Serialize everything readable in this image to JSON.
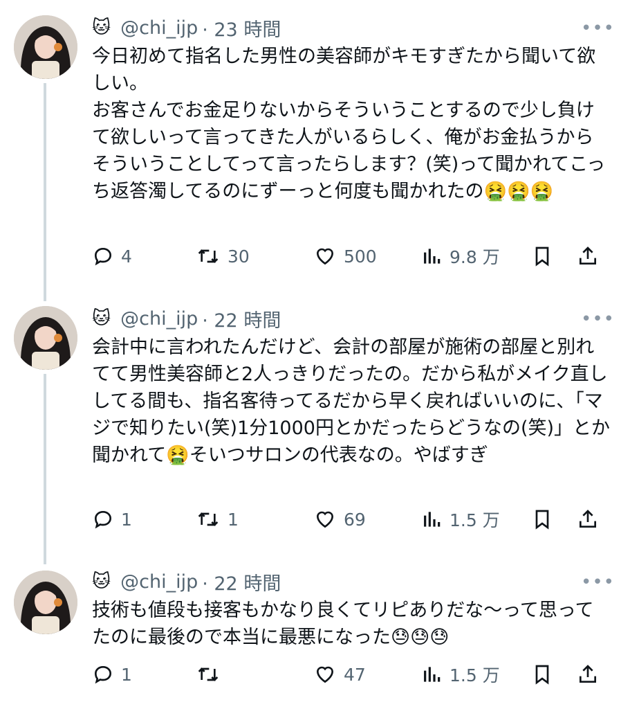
{
  "tweets": [
    {
      "handle": "@chi_ijp",
      "time": "· 23 時間",
      "more": "•••",
      "text": "今日初めて指名した男性の美容師がキモすぎたから聞いて欲しい。\nお客さんでお金足りないからそういうことするので少し負けて欲しいって言ってきた人がいるらしく、俺がお金払うからそういうことしてって言ったらします？(笑)って聞かれてこっち返答濁してるのにずーっと何度も聞かれたの🤮🤮🤮",
      "replies": "4",
      "retweets": "30",
      "likes": "500",
      "views": "9.8 万"
    },
    {
      "handle": "@chi_ijp",
      "time": "· 22 時間",
      "more": "•••",
      "text": "会計中に言われたんだけど、会計の部屋が施術の部屋と別れてて男性美容師と2人っきりだったの。だから私がメイク直ししてる間も、指名客待ってるだから早く戻ればいいのに、「マジで知りたい(笑)1分1000円とかだったらどうなの(笑)」とか聞かれて🤮そいつサロンの代表なの。やばすぎ",
      "replies": "1",
      "retweets": "1",
      "likes": "69",
      "views": "1.5 万"
    },
    {
      "handle": "@chi_ijp",
      "time": "· 22 時間",
      "more": "•••",
      "text": "技術も値段も接客もかなり良くてリピありだな〜って思ってたのに最後ので本当に最悪になった😓😓😓",
      "replies": "1",
      "retweets": "",
      "likes": "47",
      "views": "1.5 万"
    }
  ],
  "icons": {
    "name_emoji": "🐱",
    "reply": "reply-icon",
    "retweet": "retweet-icon",
    "like": "heart-icon",
    "views": "views-icon",
    "bookmark": "bookmark-icon",
    "share": "share-icon"
  },
  "colors": {
    "text": "#0f1419",
    "secondary": "#536471",
    "thread_line": "#cfd9de"
  }
}
